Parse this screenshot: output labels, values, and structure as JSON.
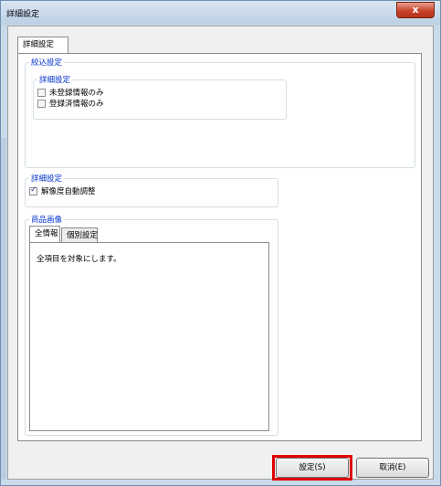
{
  "window": {
    "title": "詳細設定",
    "close_label": "x"
  },
  "tabs": [
    {
      "label": "詳細設定",
      "active": true
    }
  ],
  "filter_group": {
    "label": "絞込設定",
    "detail_group": {
      "label": "詳細設定",
      "options": [
        {
          "label": "未登録情報のみ",
          "checked": false
        },
        {
          "label": "登録済情報のみ",
          "checked": false
        }
      ]
    }
  },
  "detail_group": {
    "label": "詳細設定",
    "options": [
      {
        "label": "解像度自動調整",
        "checked": true
      }
    ]
  },
  "product_image_group": {
    "label": "商品画像",
    "tabs": [
      {
        "label": "全情報",
        "active": true
      },
      {
        "label": "個別設定",
        "active": false
      }
    ],
    "message": "全項目を対象にします。"
  },
  "buttons": {
    "ok_label": "設定(S)",
    "cancel_label": "取消(E)"
  },
  "colors": {
    "group_label": "#0033cc",
    "highlight": "#e00000",
    "close_button": "#c7452c"
  }
}
